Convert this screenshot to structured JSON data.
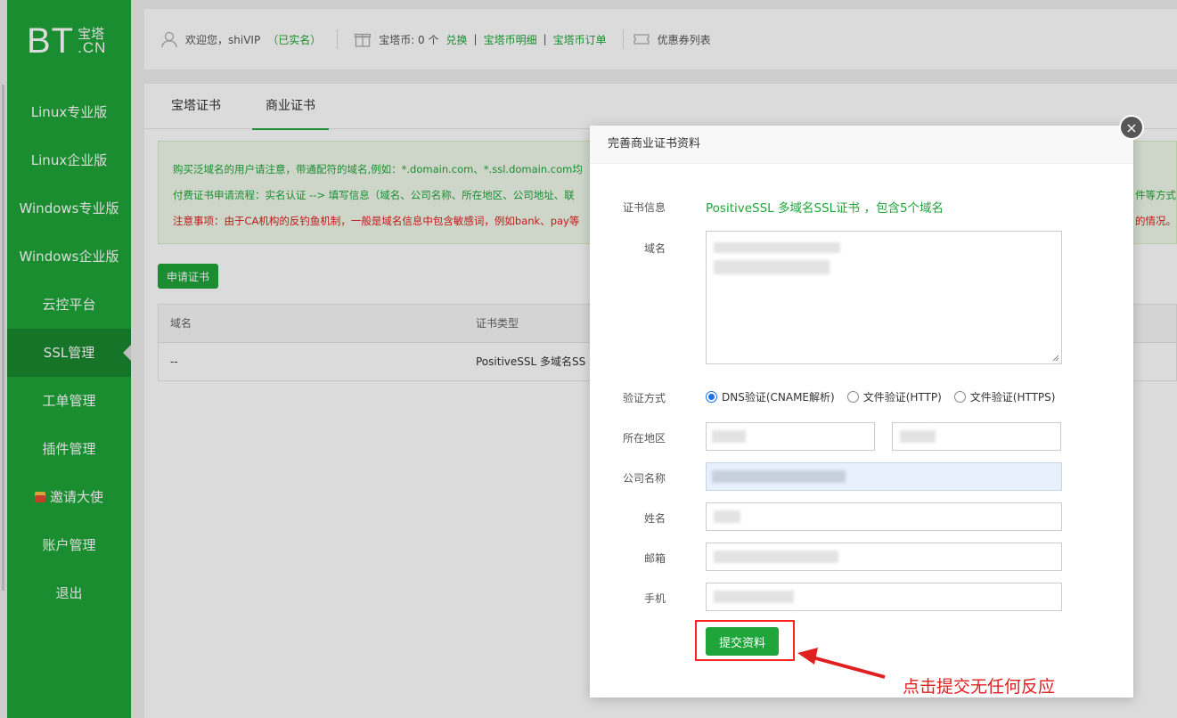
{
  "brand": {
    "bt": "BT",
    "cn": "宝塔",
    "domain": ".CN",
    "color": "#20a53a"
  },
  "sidebar": {
    "items": [
      {
        "label": "Linux专业版"
      },
      {
        "label": "Linux企业版"
      },
      {
        "label": "Windows专业版"
      },
      {
        "label": "Windows企业版"
      },
      {
        "label": "云控平台"
      },
      {
        "label": "SSL管理",
        "active": true
      },
      {
        "label": "工单管理"
      },
      {
        "label": "插件管理"
      },
      {
        "label": "邀请大使",
        "icon": "gift-icon"
      },
      {
        "label": "账户管理"
      },
      {
        "label": "退出"
      }
    ]
  },
  "topbar": {
    "welcome": "欢迎您，shiVIP",
    "verified": "（已实名）",
    "coins": "宝塔币: 0 个",
    "exchange": "兑换",
    "coin_detail": "宝塔币明细",
    "coin_orders": "宝塔币订单",
    "coupons": "优惠券列表",
    "divider": "|"
  },
  "tabs": [
    "宝塔证书",
    "商业证书"
  ],
  "notice": {
    "line1": "购买泛域名的用户请注意，带通配符的域名,例如：*.domain.com、*.ssl.domain.com均",
    "line2": "付费证书申请流程：实名认证 --> 填写信息（域名、公司名称、所在地区、公司地址、联",
    "line2_tail": "件等方式",
    "line3": "注意事项：由于CA机构的反钓鱼机制，一般是域名信息中包含敏感词，例如bank、pay等",
    "line3_tail": "的情况。"
  },
  "apply_button": "申请证书",
  "table": {
    "headers": [
      "域名",
      "证书类型"
    ],
    "rows": [
      [
        "--",
        "PositiveSSL 多域名SS"
      ]
    ]
  },
  "modal": {
    "title": "完善商业证书资料",
    "close": "×",
    "labels": {
      "cert_info": "证书信息",
      "domain": "域名",
      "verify": "验证方式",
      "region": "所在地区",
      "company": "公司名称",
      "name": "姓名",
      "email": "邮箱",
      "phone": "手机"
    },
    "cert_info_value": "PositiveSSL 多域名SSL证书 ，包含5个域名",
    "verify_options": [
      "DNS验证(CNAME解析)",
      "文件验证(HTTP)",
      "文件验证(HTTPS)"
    ],
    "verify_selected": 0,
    "submit": "提交资料"
  },
  "annotation": {
    "text": "点击提交无任何反应",
    "color": "#e02020"
  }
}
